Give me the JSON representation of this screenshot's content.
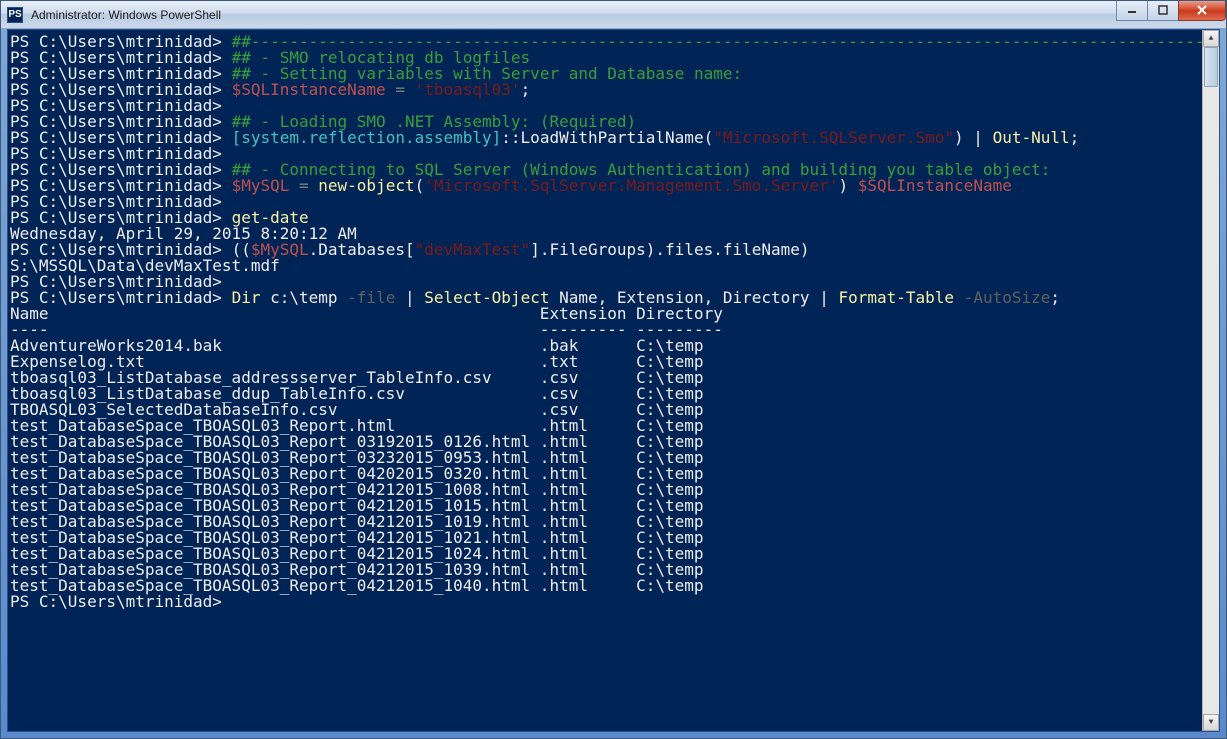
{
  "titlebar": {
    "icon_label": "PS",
    "title": "Administrator: Windows PowerShell"
  },
  "window_buttons": {
    "minimize": "minimize-button",
    "maximize": "maximize-button",
    "close": "close-button"
  },
  "prompt": "PS C:\\Users\\mtrinidad>",
  "lines": {
    "comment_dashes": "##--------------------------------------------------------------------------------------------------------------------",
    "comment_smo": "## - SMO relocating db logfiles",
    "comment_setvars": "## - Setting variables with Server and Database name:",
    "var_sqlinst": "$SQLInstanceName",
    "eq": " = ",
    "str_tboa": "'tboasql03'",
    "semicolon": ";",
    "comment_loadsmo": "## - Loading SMO .NET Assembly: (Required)",
    "type_sysref": "[system.reflection.assembly]",
    "stat_load": "::LoadWithPartialName(",
    "str_smo": "\"Microsoft.SQLServer.Smo\"",
    "close_paren": ")",
    "pipe": " | ",
    "outnull": "Out-Null",
    "comment_conn": "## - Connecting to SQL Server (Windows Authentication) and building you table object:",
    "var_mysql": "$MySQL",
    "newobj": "new-object",
    "paren_open": "(",
    "str_smoserver": "'Microsoft.SqlServer.Management.Smo.Server'",
    "sp": " ",
    "getdate": "get-date",
    "date_output": "Wednesday, April 29, 2015 8:20:12 AM",
    "openp2": "((",
    "dot_db": ".Databases[",
    "str_devmax": "\"devMaxTest\"",
    "close_idx": "].FileGroups).files.fileName)",
    "mdf_path": "S:\\MSSQL\\Data\\devMaxTest.mdf",
    "dir": "Dir",
    "ctemp": " c:\\temp",
    "dash_file": " -file",
    "selectobj": "Select-Object",
    "selcols": " Name, Extension, Directory",
    "formattable": "Format-Table",
    "dash_auto": " -AutoSize",
    "hdr_name": "Name",
    "hdr_ext": "Extension",
    "hdr_dir": "Directory",
    "dash_name": "----",
    "dash_ext": "---------",
    "dash_dir": "---------"
  },
  "chart_data": {
    "type": "table",
    "title": "Dir c:\\temp -file | Select-Object Name, Extension, Directory | Format-Table -AutoSize",
    "columns": [
      "Name",
      "Extension",
      "Directory"
    ],
    "rows": [
      [
        "AdventureWorks2014.bak",
        ".bak",
        "C:\\temp"
      ],
      [
        "Expenselog.txt",
        ".txt",
        "C:\\temp"
      ],
      [
        "tboasql03_ListDatabase_addressserver_TableInfo.csv",
        ".csv",
        "C:\\temp"
      ],
      [
        "tboasql03_ListDatabase_ddup_TableInfo.csv",
        ".csv",
        "C:\\temp"
      ],
      [
        "TBOASQL03_SelectedDatabaseInfo.csv",
        ".csv",
        "C:\\temp"
      ],
      [
        "test_DatabaseSpace_TBOASQL03_Report.html",
        ".html",
        "C:\\temp"
      ],
      [
        "test_DatabaseSpace_TBOASQL03_Report_03192015_0126.html",
        ".html",
        "C:\\temp"
      ],
      [
        "test_DatabaseSpace_TBOASQL03_Report_03232015_0953.html",
        ".html",
        "C:\\temp"
      ],
      [
        "test_DatabaseSpace_TBOASQL03_Report_04202015_0320.html",
        ".html",
        "C:\\temp"
      ],
      [
        "test_DatabaseSpace_TBOASQL03_Report_04212015_1008.html",
        ".html",
        "C:\\temp"
      ],
      [
        "test_DatabaseSpace_TBOASQL03_Report_04212015_1015.html",
        ".html",
        "C:\\temp"
      ],
      [
        "test_DatabaseSpace_TBOASQL03_Report_04212015_1019.html",
        ".html",
        "C:\\temp"
      ],
      [
        "test_DatabaseSpace_TBOASQL03_Report_04212015_1021.html",
        ".html",
        "C:\\temp"
      ],
      [
        "test_DatabaseSpace_TBOASQL03_Report_04212015_1024.html",
        ".html",
        "C:\\temp"
      ],
      [
        "test_DatabaseSpace_TBOASQL03_Report_04212015_1039.html",
        ".html",
        "C:\\temp"
      ],
      [
        "test_DatabaseSpace_TBOASQL03_Report_04212015_1040.html",
        ".html",
        "C:\\temp"
      ]
    ]
  }
}
